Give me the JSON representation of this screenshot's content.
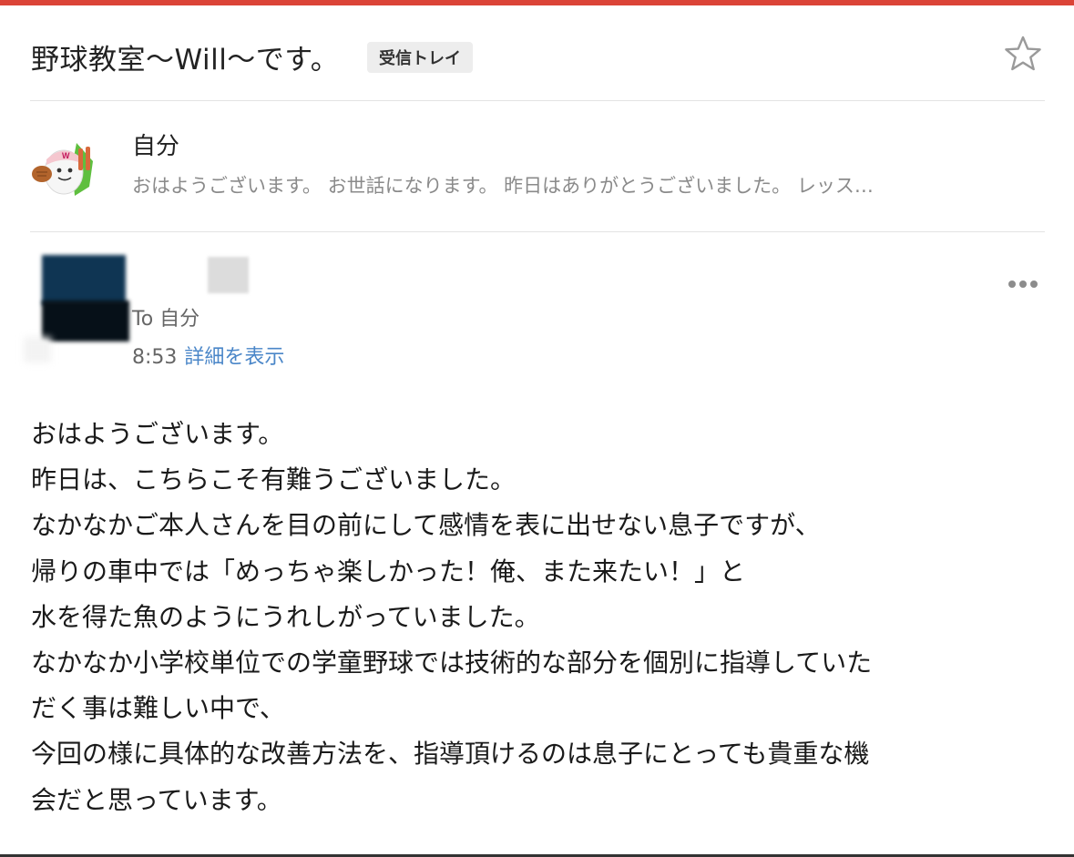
{
  "thread": {
    "subject": "野球教室〜Will〜です。",
    "label": "受信トレイ",
    "accent_color": "#db4437"
  },
  "messages": [
    {
      "state": "collapsed",
      "sender": "自分",
      "snippet": "おはようございます。 お世話になります。 昨日はありがとうございました。 レッス…"
    },
    {
      "state": "expanded",
      "to": "To 自分",
      "time": "8:53",
      "details_link": "詳細を表示",
      "body_lines": [
        "おはようございます。",
        "昨日は、こちらこそ有難うございました。",
        "なかなかご本人さんを目の前にして感情を表に出せない息子ですが、",
        "帰りの車中では「めっちゃ楽しかった！俺、また来たい！」と",
        "水を得た魚のようにうれしがっていました。",
        "なかなか小学校単位での学童野球では技術的な部分を個別に指導していた",
        "だく事は難しい中で、",
        "今回の様に具体的な改善方法を、指導頂けるのは息子にとっても貴重な機",
        "会だと思っています。"
      ]
    }
  ],
  "icons": {
    "star": "star-outline-icon",
    "more": "more-horizontal-icon",
    "link_color": "#4a86c8"
  }
}
